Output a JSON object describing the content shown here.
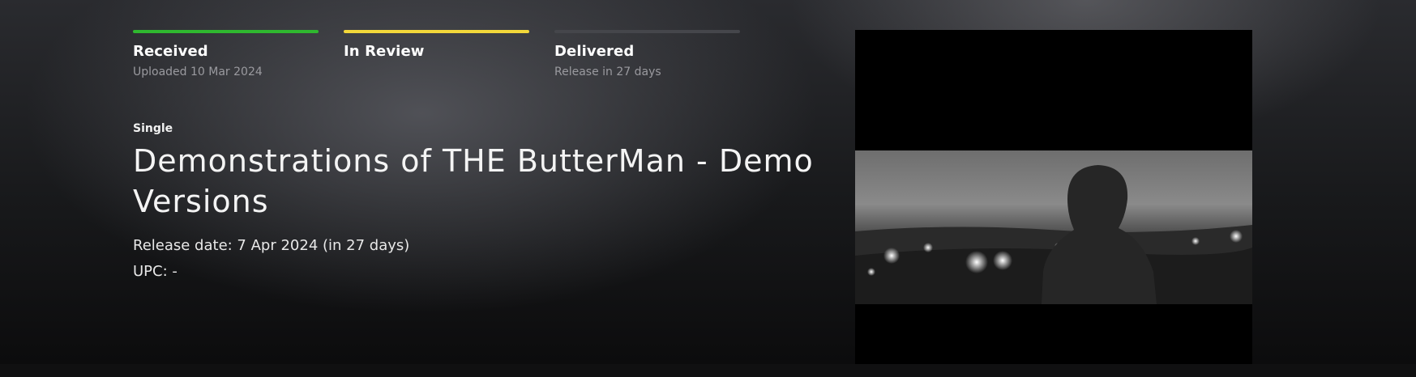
{
  "progress": {
    "steps": [
      {
        "title": "Received",
        "subtitle": "Uploaded 10 Mar 2024",
        "color": "#2fb82f"
      },
      {
        "title": "In Review",
        "subtitle": "",
        "color": "#f3d83a"
      },
      {
        "title": "Delivered",
        "subtitle": "Release in 27 days",
        "color": "#45464b"
      }
    ]
  },
  "release": {
    "type": "Single",
    "title": "Demonstrations of THE ButterMan - Demo Versions",
    "release_date": "Release date: 7 Apr 2024 (in 27 days)",
    "upc": "UPC: -"
  },
  "artwork": {
    "icon": "cover-art-image"
  }
}
